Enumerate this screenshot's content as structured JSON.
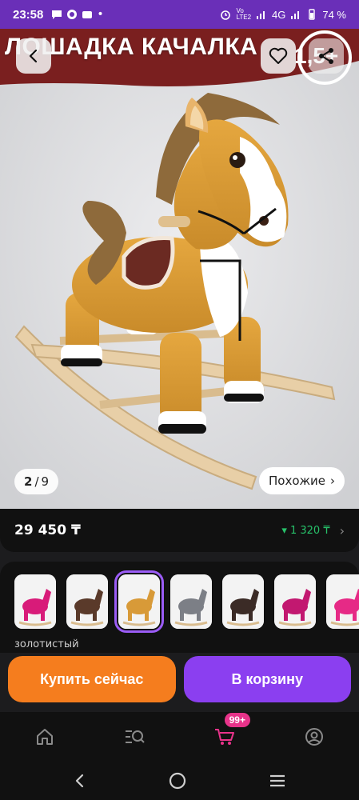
{
  "status_bar": {
    "time": "23:58",
    "battery": "74 %",
    "network": "4G"
  },
  "banner": {
    "title": "ЛОШАДКА КАЧАЛКА",
    "number": "1,5+"
  },
  "image_counter": {
    "current": "2",
    "total": "9"
  },
  "similar_button": {
    "label": "Похожие",
    "arrow": "›"
  },
  "price": {
    "value": "29 450 ₸",
    "bonus": "▾ 1 320 ₸",
    "arrow": "›"
  },
  "variants": {
    "selected_label": "золотистый",
    "items": [
      {
        "name": "pink horse",
        "color": "#d81b79"
      },
      {
        "name": "girl with brown horse",
        "color": "#5a3a2a"
      },
      {
        "name": "golden horse",
        "color": "#d89a38"
      },
      {
        "name": "girl with grey horse",
        "color": "#7c7f86"
      },
      {
        "name": "girl with dark horse",
        "color": "#3b2b26"
      },
      {
        "name": "girl with pink horse",
        "color": "#c21870"
      },
      {
        "name": "pink horse 2",
        "color": "#e62a86"
      }
    ]
  },
  "actions": {
    "buy_now": "Купить сейчас",
    "add_to_cart": "В корзину"
  },
  "bottom_nav": {
    "cart_badge": "99+"
  },
  "colors": {
    "accent": "#8b3ff0",
    "buy": "#f57d1e",
    "bonus": "#27c26a",
    "statusbar": "#6a2fb8"
  }
}
